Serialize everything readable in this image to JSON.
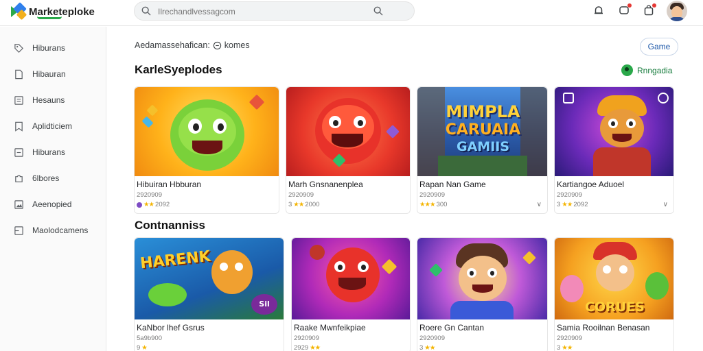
{
  "header": {
    "app_name": "Marketeploke",
    "search": {
      "placeholder": "Ilrechandlvessagcom",
      "value": ""
    },
    "icons": [
      "bell-icon",
      "notification-icon",
      "shopping-bag-icon",
      "avatar"
    ]
  },
  "sidebar": {
    "items": [
      {
        "label": "Hiburans",
        "icon": "tag-icon"
      },
      {
        "label": "Hibauran",
        "icon": "file-icon"
      },
      {
        "label": "Hesauns",
        "icon": "list-icon"
      },
      {
        "label": "Aplidticiem",
        "icon": "bookmark-icon"
      },
      {
        "label": "Hiburans",
        "icon": "note-icon"
      },
      {
        "label": "6lbores",
        "icon": "puzzle-icon"
      },
      {
        "label": "Aeenopied",
        "icon": "image-icon"
      },
      {
        "label": "Maolodcamens",
        "icon": "box-icon"
      }
    ]
  },
  "main": {
    "breadcrumb": {
      "prefix": "Aedamassehafican:",
      "current": "komes"
    },
    "game_button": "Game",
    "section1": {
      "title": "KarleSyeplodes",
      "see_more": "Rnngadia",
      "cards": [
        {
          "title": "Hibuiran Hbburan",
          "meta": "2920909",
          "rating": "2092",
          "stars": "★★",
          "purple": true,
          "chevron": false
        },
        {
          "title": "Marh Gnsnanenplea",
          "meta": "2920909",
          "rating": "2000",
          "stars": "★★",
          "prefix": "3",
          "chevron": false
        },
        {
          "title": "Rapan Nan Game",
          "meta": "2920909",
          "rating": "300",
          "stars": "★★★",
          "chevron": true,
          "art_text": [
            "MIMPLA",
            "CARUAIA",
            "GAMIIS"
          ]
        },
        {
          "title": "Kartiangoe Aduoel",
          "meta": "2920909",
          "rating": "2092",
          "stars": "★★",
          "prefix": "3",
          "chevron": true
        }
      ]
    },
    "section2": {
      "title": "Contnanniss",
      "cards": [
        {
          "title": "KaNbor lhef Gsrus",
          "meta": "5a9b900",
          "rating": "",
          "stars": "★",
          "prefix": "9",
          "art_text": [
            "HARENK"
          ],
          "badge": "Sil"
        },
        {
          "title": "Raake Mwnfeikpiae",
          "meta": "2920909",
          "rating": "",
          "stars": "★★",
          "prefix": "2929"
        },
        {
          "title": "Roere Gn Cantan",
          "meta": "2920909",
          "rating": "",
          "stars": "★★",
          "prefix": "3"
        },
        {
          "title": "Samia Rooilnan Benasan",
          "meta": "2920909",
          "rating": "",
          "stars": "★★",
          "prefix": "3",
          "art_text": [
            "CORUES"
          ]
        }
      ]
    }
  }
}
